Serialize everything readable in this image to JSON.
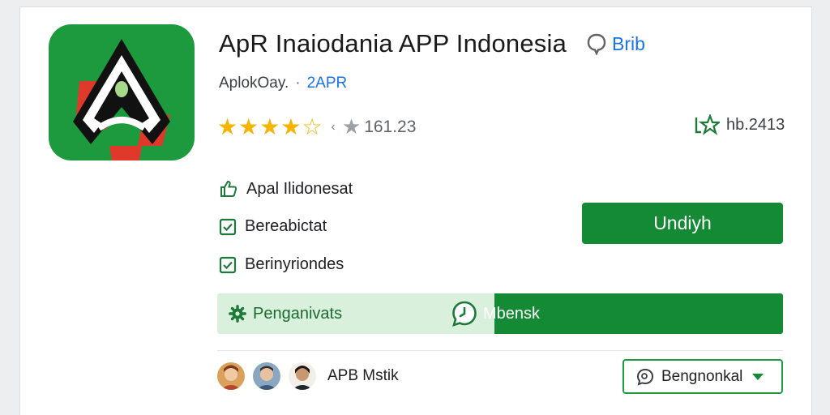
{
  "app": {
    "title": "ApR Inaiodania APP Indonesia",
    "share_label": "Brib",
    "developer": "AplokOay.",
    "separator": "·",
    "tag": "2APR"
  },
  "rating": {
    "stars_value": 4.5,
    "stars_max": 5,
    "separator": "‹",
    "review_count": "161.23"
  },
  "downloads": {
    "value": "hb.2413"
  },
  "features": [
    {
      "label": "Apal Ilidonesat",
      "icon": "thumbs-up-icon"
    },
    {
      "label": "Bereabictat",
      "icon": "checkbox-icon"
    },
    {
      "label": "Berinyriondes",
      "icon": "checkbox-icon"
    }
  ],
  "install": {
    "label": "Undiyh"
  },
  "progress": {
    "left_label": "Penganivats",
    "right_label": "Mbensk",
    "fill_fraction": 0.51
  },
  "reviewers": {
    "label": "APB Mstik"
  },
  "dropdown": {
    "label": "Bengnonkal"
  },
  "colors": {
    "accent": "#148a34",
    "icon_bg": "#1e9a3e",
    "star": "#f4b400",
    "link": "#1a73e8",
    "progress_track": "#d9f0dc"
  }
}
